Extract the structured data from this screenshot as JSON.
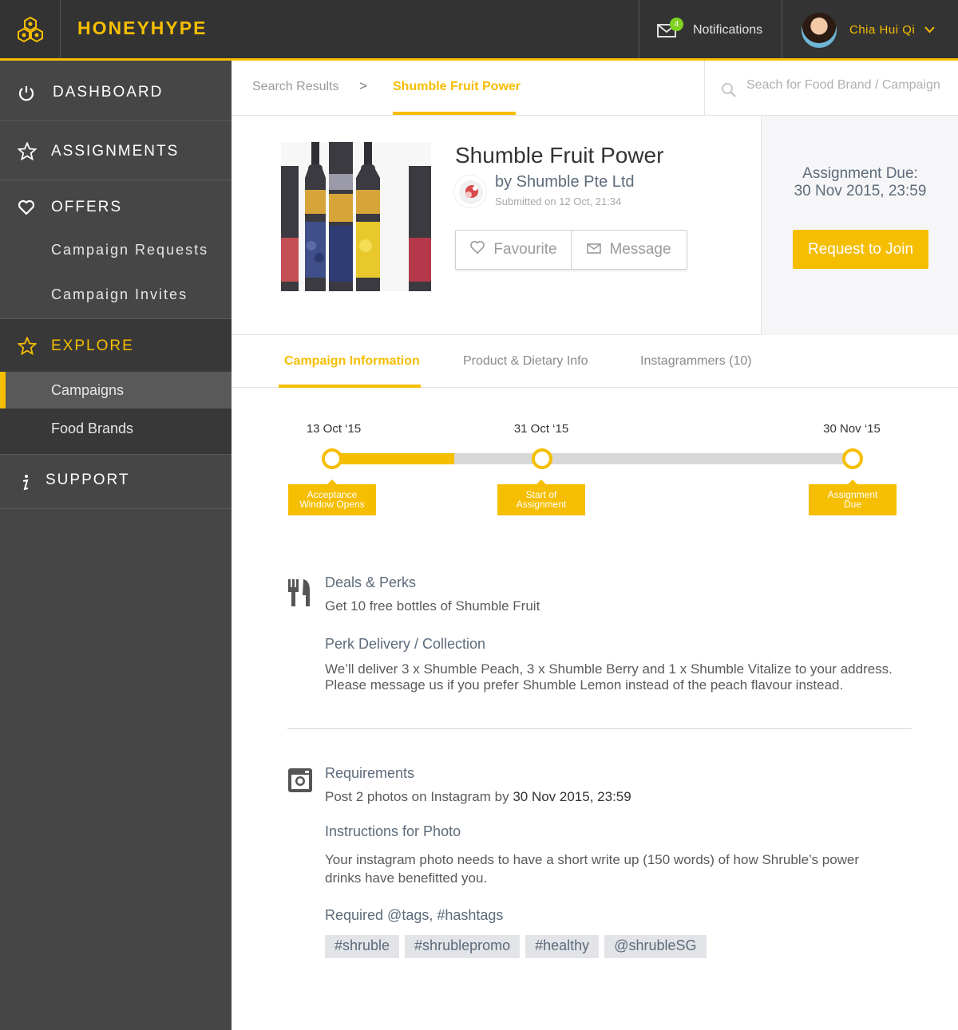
{
  "app": {
    "brand": "HONEYHYPE",
    "accent_color": "#f6be00",
    "logo_icon": "honeycomb-logo-icon"
  },
  "header": {
    "notifications": {
      "label": "Notifications",
      "count": "4",
      "icon": "mail-icon"
    },
    "user": {
      "name": "Chia Hui Qi",
      "icon": "chevron-down-icon"
    }
  },
  "sidebar": {
    "dashboard": "DASHBOARD",
    "assignments": "ASSIGNMENTS",
    "offers": "OFFERS",
    "offers_items": [
      "Campaign Requests",
      "Campaign Invites"
    ],
    "explore": "EXPLORE",
    "explore_items": [
      "Campaigns",
      "Food Brands"
    ],
    "active_item": "Campaigns",
    "support": "SUPPORT"
  },
  "breadcrumb": {
    "parent": "Search Results",
    "separator": ">",
    "current": "Shumble Fruit Power"
  },
  "search": {
    "placeholder": "Seach for Food Brand / Campaign"
  },
  "campaign": {
    "title": "Shumble Fruit Power",
    "by": "by Shumble Pte Ltd",
    "submitted": "Submitted on 12 Oct, 21:34",
    "favourite_label": "Favourite",
    "message_label": "Message",
    "due_label": "Assignment Due:",
    "due_value": "30 Nov 2015, 23:59",
    "join_label": "Request to Join"
  },
  "tabs": [
    "Campaign Information",
    "Product & Dietary Info",
    "Instagrammers (10)"
  ],
  "active_tab": "Campaign Information",
  "timeline": {
    "progress": 0.235,
    "milestones": [
      {
        "date": "13 Oct ‘15",
        "label_line1": "Acceptance",
        "label_line2": "Window Opens"
      },
      {
        "date": "31 Oct ‘15",
        "label_line1": "Start of",
        "label_line2": "Assignment"
      },
      {
        "date": "30 Nov ‘15",
        "label_line1": "Assignment",
        "label_line2": "Due"
      }
    ]
  },
  "deals": {
    "heading": "Deals & Perks",
    "text": "Get 10 free bottles of Shumble Fruit",
    "delivery_heading": "Perk Delivery / Collection",
    "delivery_line1": "We’ll deliver 3 x Shumble Peach, 3 x Shumble Berry and 1 x Shumble Vitalize to your address.",
    "delivery_line2": "Please message us if you prefer Shumble Lemon instead of the peach flavour instead."
  },
  "requirements": {
    "heading": "Requirements",
    "text_prefix": "Post 2 photos on Instagram by ",
    "text_deadline": "30 Nov 2015, 23:59",
    "instructions_heading": "Instructions for Photo",
    "instructions_line1": "Your instagram photo needs to have a short write up (150 words) of how Shruble’s power",
    "instructions_line2": "drinks have benefitted you.",
    "tags_heading": "Required @tags, #hashtags",
    "tags": [
      "#shruble",
      "#shrublepromo",
      "#healthy",
      "@shrubleSG"
    ]
  }
}
